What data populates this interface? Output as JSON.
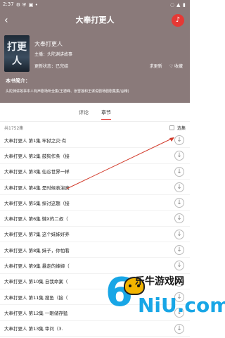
{
  "status_bar": {
    "time": "2:37",
    "left_icons": [
      "settings-icon",
      "shield-icon",
      "app-icon",
      "notification-icon"
    ],
    "right_icons": [
      "wifi-icon",
      "signal-icon",
      "battery-icon"
    ]
  },
  "header": {
    "title": "大奉打更人",
    "back_icon": "back-arrow-icon",
    "action_icon": "music-note-icon"
  },
  "book": {
    "cover_label": "打更人",
    "name": "大奉打更人",
    "host": "主播：头陀渊讲故事",
    "status": "更新状态：已完结",
    "actions": [
      "求更新",
      "收藏"
    ]
  },
  "intro": {
    "title": "本书简介：",
    "text": "头陀渊讲故事本人有声剧场听全集(王德峰、张雪莲和王谋说剧场剧剧集集/@精)"
  },
  "tabs": [
    "评论",
    "章节"
  ],
  "meta": {
    "count": "共1752集",
    "select": "选集"
  },
  "chapters": [
    "大奉打更人 第1集 牢狱之灾·有",
    "大奉打更人 第2集 鼓狗作条（接",
    "大奉打更人 第3集 仙谷世界一样",
    "大奉打更人 第4集 是时候表演真",
    "大奉打更人 第5集 探讨这题（接",
    "大奉打更人 第6集 懒X的二叔（",
    "大奉打更人 第7集 这个妹妹好养",
    "大奉打更人 第8集 妹子，你怕看",
    "大奉打更人 第9集 暴走的婶婶（",
    "大奉打更人 第10集 自我命案（",
    "大奉打更人 第11集 搜鱼（接（",
    "大奉打更人 第12集 一眼储存猛",
    "大奉打更人 第13集 审问（3."
  ],
  "watermark": {
    "cn": "乐牛游戏网",
    "en": "NiU.com"
  }
}
